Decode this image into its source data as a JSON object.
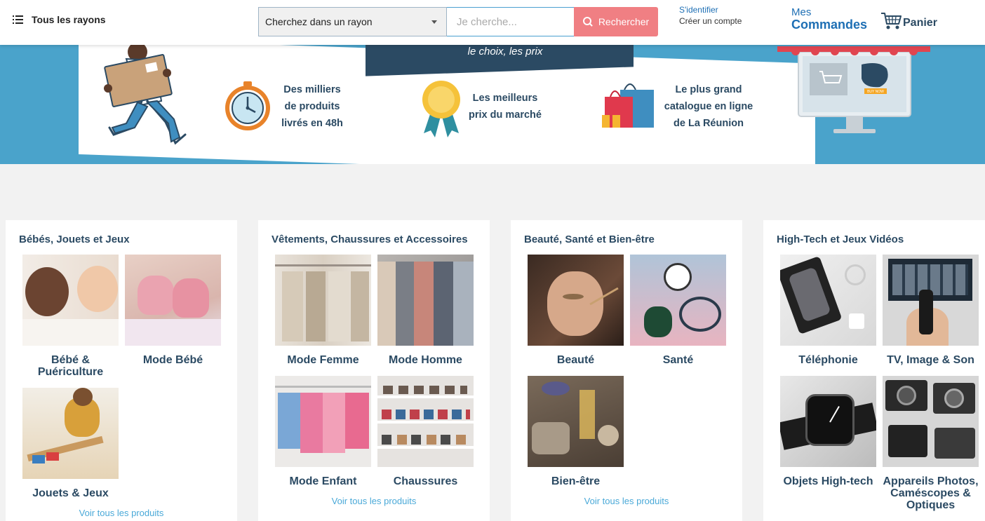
{
  "header": {
    "menu_label": "Tous les rayons",
    "rayon_select": "Cherchez dans un rayon",
    "search_placeholder": "Je cherche...",
    "search_button": "Rechercher",
    "login": "S'identifier",
    "register": "Créer un compte",
    "orders_line1": "Mes",
    "orders_line2": "Commandes",
    "cart": "Panier"
  },
  "banner": {
    "tagline": "le choix, les prix",
    "features": [
      {
        "text": "Des milliers\nde produits\nlivrés en 48h",
        "icon": "stopwatch-icon"
      },
      {
        "text": "Les meilleurs\nprix du marché",
        "icon": "medal-icon"
      },
      {
        "text": "Le plus grand\ncatalogue en ligne\nde La Réunion",
        "icon": "shopping-bags-icon"
      }
    ],
    "buy_now": "BUY NOW"
  },
  "categories": [
    {
      "title": "Bébés, Jouets et Jeux",
      "items": [
        {
          "label": "Bébé & Puériculture",
          "image": "babies-photo"
        },
        {
          "label": "Mode Bébé",
          "image": "baby-shoes-photo"
        },
        {
          "label": "Jouets & Jeux",
          "image": "toy-train-photo"
        }
      ],
      "see_all": "Voir tous les produits"
    },
    {
      "title": "Vêtements, Chaussures et Accessoires",
      "items": [
        {
          "label": "Mode Femme",
          "image": "women-clothes-photo"
        },
        {
          "label": "Mode Homme",
          "image": "men-shirts-photo"
        },
        {
          "label": "Mode Enfant",
          "image": "kids-clothes-photo"
        },
        {
          "label": "Chaussures",
          "image": "shoes-rack-photo"
        }
      ],
      "see_all": "Voir tous les produits"
    },
    {
      "title": "Beauté, Santé et Bien-être",
      "items": [
        {
          "label": "Beauté",
          "image": "makeup-photo"
        },
        {
          "label": "Santé",
          "image": "stethoscope-photo"
        },
        {
          "label": "Bien-être",
          "image": "essential-oils-photo"
        }
      ],
      "see_all": "Voir tous les produits"
    },
    {
      "title": "High-Tech et Jeux Vidéos",
      "items": [
        {
          "label": "Téléphonie",
          "image": "smartphone-box-photo"
        },
        {
          "label": "TV, Image & Son",
          "image": "tv-remote-photo"
        },
        {
          "label": "Objets High-tech",
          "image": "smartwatch-photo"
        },
        {
          "label": "Appareils Photos, Caméscopes & Optiques",
          "image": "cameras-photo"
        }
      ]
    }
  ],
  "colors": {
    "brand_dark": "#2b4a63",
    "banner_blue": "#4aa3cb",
    "search_button": "#f07f83",
    "link_blue": "#1e6fb4"
  }
}
